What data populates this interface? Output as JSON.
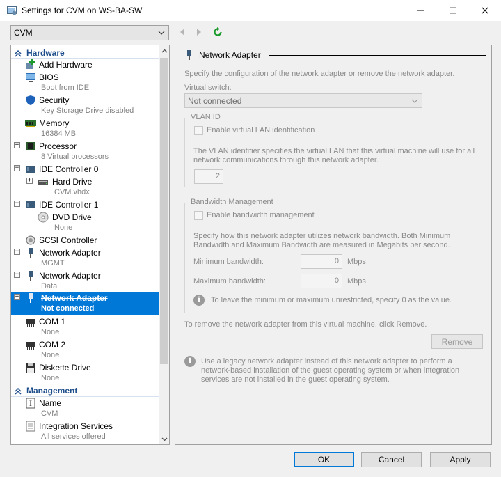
{
  "window": {
    "title": "Settings for CVM on WS-BA-SW"
  },
  "vm_selector": {
    "value": "CVM"
  },
  "tree": {
    "sections": [
      {
        "label": "Hardware"
      },
      {
        "label": "Management"
      }
    ],
    "items": [
      {
        "name": "Add Hardware",
        "sub": ""
      },
      {
        "name": "BIOS",
        "sub": "Boot from IDE"
      },
      {
        "name": "Security",
        "sub": "Key Storage Drive disabled"
      },
      {
        "name": "Memory",
        "sub": "16384 MB"
      },
      {
        "name": "Processor",
        "sub": "8 Virtual processors"
      },
      {
        "name": "IDE Controller 0",
        "sub": ""
      },
      {
        "name": "Hard Drive",
        "sub": "CVM.vhdx"
      },
      {
        "name": "IDE Controller 1",
        "sub": ""
      },
      {
        "name": "DVD Drive",
        "sub": "None"
      },
      {
        "name": "SCSI Controller",
        "sub": ""
      },
      {
        "name": "Network Adapter",
        "sub": "MGMT"
      },
      {
        "name": "Network Adapter",
        "sub": "Data"
      },
      {
        "name": "Network Adapter",
        "sub": "Not connected"
      },
      {
        "name": "COM 1",
        "sub": "None"
      },
      {
        "name": "COM 2",
        "sub": "None"
      },
      {
        "name": "Diskette Drive",
        "sub": "None"
      },
      {
        "name": "Name",
        "sub": "CVM"
      },
      {
        "name": "Integration Services",
        "sub": "All services offered"
      }
    ]
  },
  "panel": {
    "title": "Network Adapter",
    "description": "Specify the configuration of the network adapter or remove the network adapter.",
    "virtual_switch_label": "Virtual switch:",
    "virtual_switch_value": "Not connected",
    "vlan": {
      "group_label": "VLAN ID",
      "checkbox_label": "Enable virtual LAN identification",
      "help_line1": "The VLAN identifier specifies the virtual LAN that this virtual machine will use for all",
      "help_line2": "network communications through this network adapter.",
      "value": "2"
    },
    "bandwidth": {
      "group_label": "Bandwidth Management",
      "checkbox_label": "Enable bandwidth management",
      "help_line1": "Specify how this network adapter utilizes network bandwidth. Both Minimum",
      "help_line2": "Bandwidth and Maximum Bandwidth are measured in Megabits per second.",
      "min_label": "Minimum bandwidth:",
      "min_value": "0",
      "max_label": "Maximum bandwidth:",
      "max_value": "0",
      "unit": "Mbps",
      "info": "To leave the minimum or maximum unrestricted, specify 0 as the value."
    },
    "remove_text": "To remove the network adapter from this virtual machine, click Remove.",
    "remove_button": "Remove",
    "legacy_line1": "Use a legacy network adapter instead of this network adapter to perform a",
    "legacy_line2": "network-based installation of the guest operating system or when integration",
    "legacy_line3": "services are not installed in the guest operating system."
  },
  "buttons": {
    "ok": "OK",
    "cancel": "Cancel",
    "apply": "Apply"
  },
  "colors": {
    "accent": "#0078d7",
    "section_header": "#1f4e8c"
  }
}
